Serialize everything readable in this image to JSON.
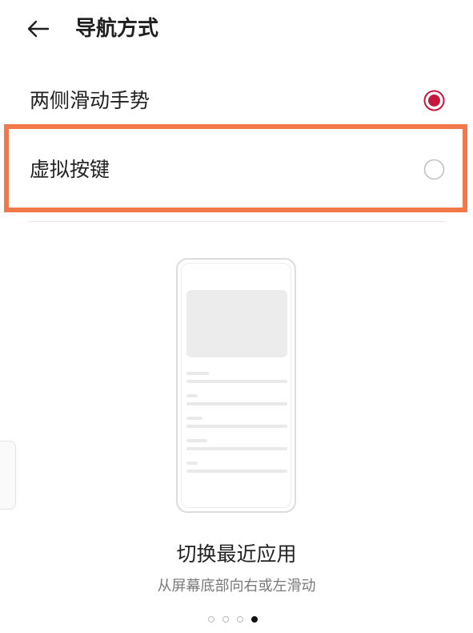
{
  "header": {
    "title": "导航方式",
    "back_icon": "arrow-left-icon"
  },
  "options": [
    {
      "label": "两侧滑动手势",
      "selected": true
    },
    {
      "label": "虚拟按键",
      "selected": false
    }
  ],
  "colors": {
    "accent": "#c8173f",
    "highlight": "#f1784a"
  },
  "illustration": {
    "title": "切换最近应用",
    "description": "从屏幕底部向右或左滑动"
  },
  "pager": {
    "count": 4,
    "active_index": 3
  }
}
